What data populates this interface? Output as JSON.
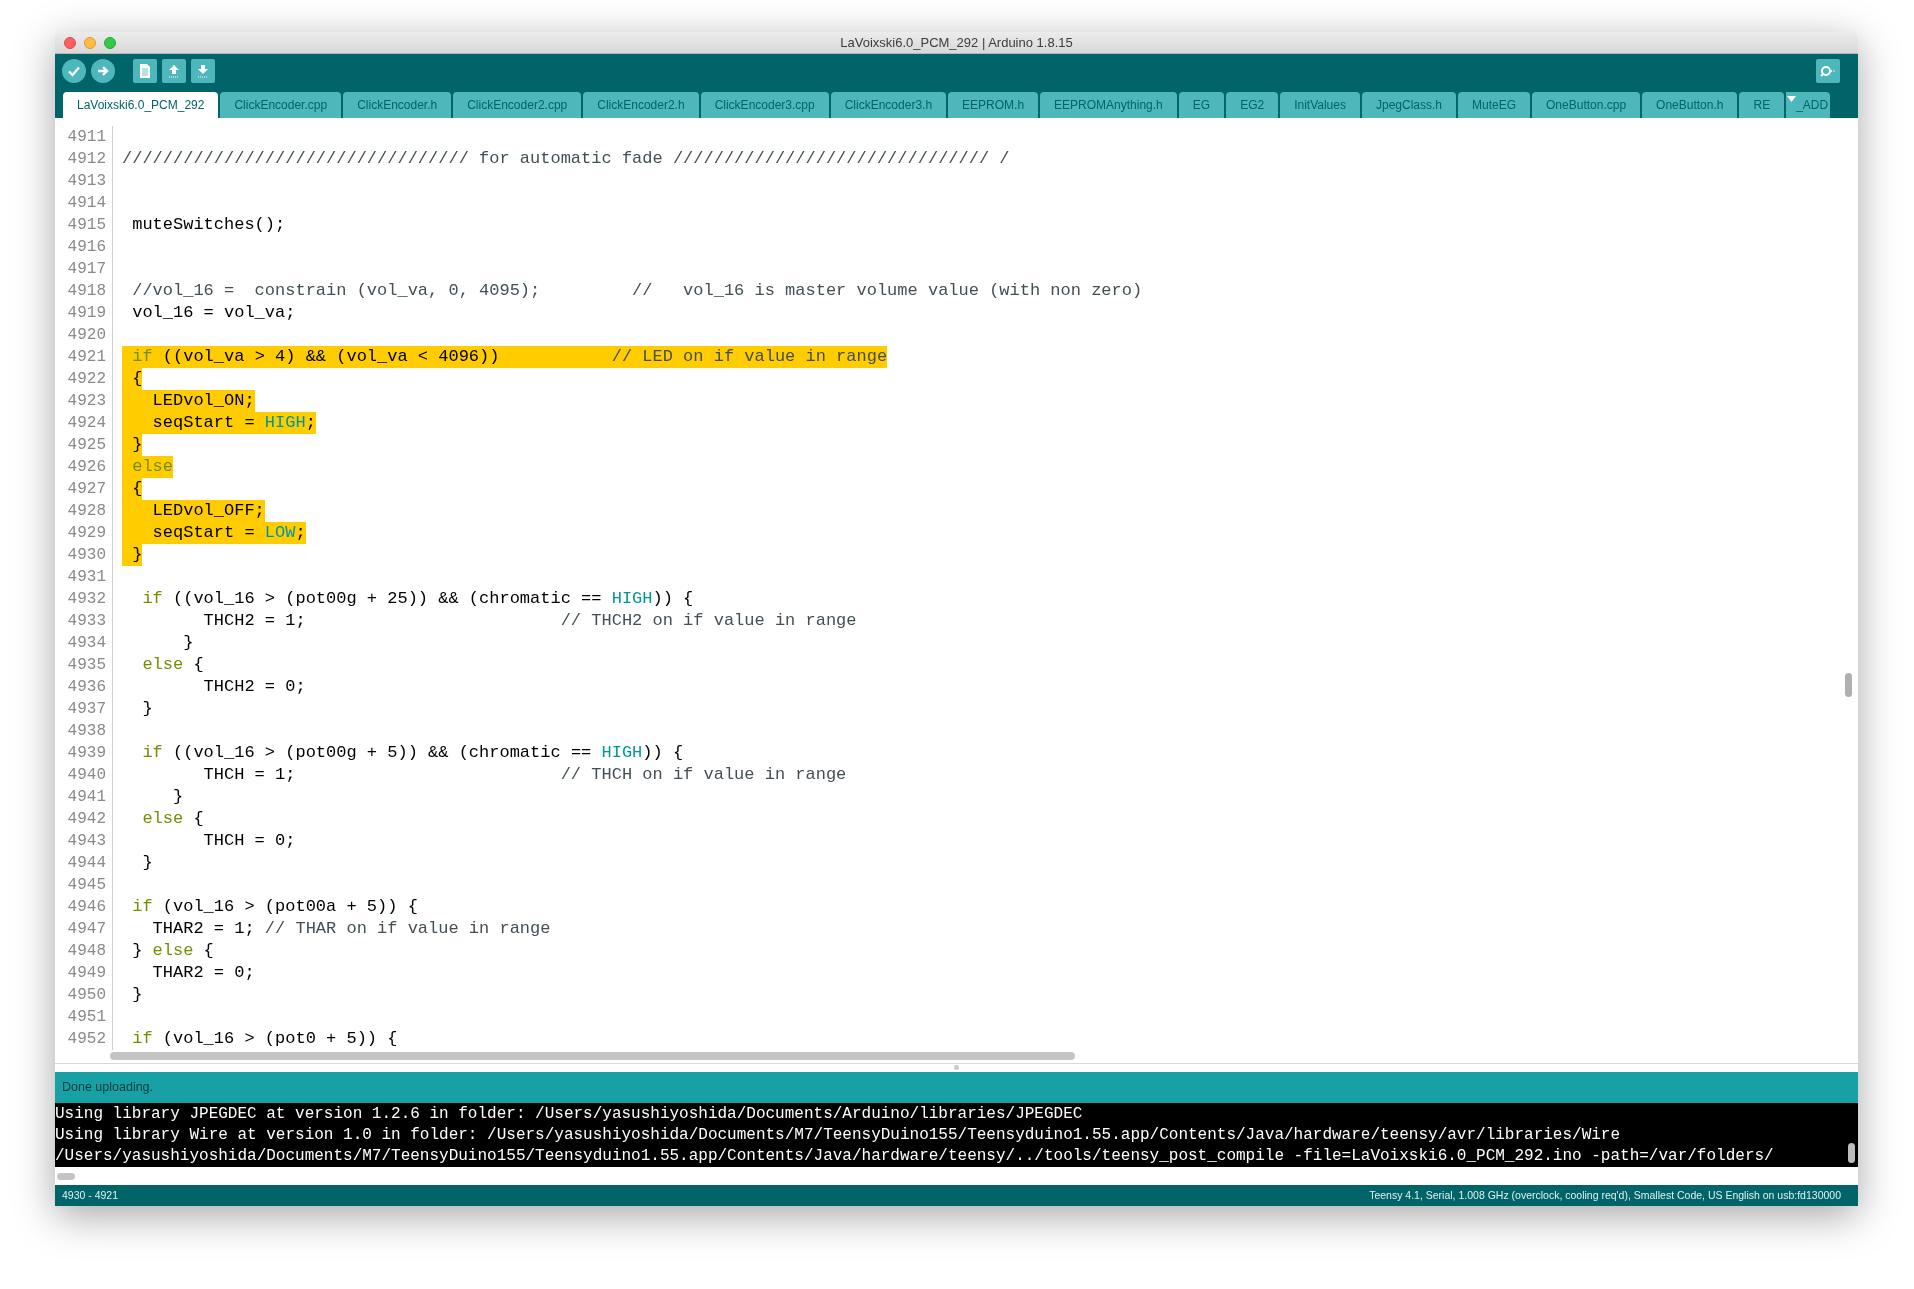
{
  "window": {
    "title": "LaVoixski6.0_PCM_292 | Arduino 1.8.15"
  },
  "tabs": [
    {
      "label": "LaVoixski6.0_PCM_292",
      "selected": true
    },
    {
      "label": "ClickEncoder.cpp",
      "selected": false
    },
    {
      "label": "ClickEncoder.h",
      "selected": false
    },
    {
      "label": "ClickEncoder2.cpp",
      "selected": false
    },
    {
      "label": "ClickEncoder2.h",
      "selected": false
    },
    {
      "label": "ClickEncoder3.cpp",
      "selected": false
    },
    {
      "label": "ClickEncoder3.h",
      "selected": false
    },
    {
      "label": "EEPROM.h",
      "selected": false
    },
    {
      "label": "EEPROMAnything.h",
      "selected": false
    },
    {
      "label": "EG",
      "selected": false
    },
    {
      "label": "EG2",
      "selected": false
    },
    {
      "label": "InitValues",
      "selected": false
    },
    {
      "label": "JpegClass.h",
      "selected": false
    },
    {
      "label": "MuteEG",
      "selected": false
    },
    {
      "label": "OneButton.cpp",
      "selected": false
    },
    {
      "label": "OneButton.h",
      "selected": false
    },
    {
      "label": "RE",
      "selected": false
    }
  ],
  "tabs_menu_text": "_ADD",
  "lines": [
    {
      "number": "4911"
    },
    {
      "number": "4912",
      "highlighted": false,
      "tokens": [
        {
          "text": "////////////////////////////////// for automatic fade /////////////////////////////// /",
          "kind": "comment"
        }
      ]
    },
    {
      "number": "4913"
    },
    {
      "number": "4914"
    },
    {
      "number": "4915",
      "highlighted": false,
      "tokens": [
        {
          "text": " muteSwitches();",
          "kind": "plain"
        }
      ]
    },
    {
      "number": "4916"
    },
    {
      "number": "4917"
    },
    {
      "number": "4918",
      "highlighted": false,
      "tokens": [
        {
          "text": " //vol_16 =  constrain (vol_va, 0, 4095);         //   vol_16 is master volume value (with non zero)",
          "kind": "comment"
        }
      ]
    },
    {
      "number": "4919",
      "highlighted": false,
      "tokens": [
        {
          "text": " vol_16 = vol_va;",
          "kind": "plain"
        }
      ]
    },
    {
      "number": "4920"
    },
    {
      "number": "4921",
      "highlighted": true,
      "tokens": [
        {
          "text": " if",
          "kind": "keyword"
        },
        {
          "text": " ((vol_va > 4) && (vol_va < 4096))           ",
          "kind": "plain"
        },
        {
          "text": "// LED on if value in range",
          "kind": "comment"
        }
      ]
    },
    {
      "number": "4922",
      "highlighted": true,
      "tokens": [
        {
          "text": " {",
          "kind": "plain"
        }
      ]
    },
    {
      "number": "4923",
      "highlighted": true,
      "tokens": [
        {
          "text": "   LEDvol_ON;",
          "kind": "plain"
        }
      ]
    },
    {
      "number": "4924",
      "highlighted": true,
      "tokens": [
        {
          "text": "   seqStart = ",
          "kind": "plain"
        },
        {
          "text": "HIGH",
          "kind": "constant"
        },
        {
          "text": ";",
          "kind": "plain"
        }
      ]
    },
    {
      "number": "4925",
      "highlighted": true,
      "tokens": [
        {
          "text": " }",
          "kind": "plain"
        }
      ]
    },
    {
      "number": "4926",
      "highlighted": true,
      "tokens": [
        {
          "text": " else",
          "kind": "keyword"
        }
      ]
    },
    {
      "number": "4927",
      "highlighted": true,
      "tokens": [
        {
          "text": " {",
          "kind": "plain"
        }
      ]
    },
    {
      "number": "4928",
      "highlighted": true,
      "tokens": [
        {
          "text": "   LEDvol_OFF;",
          "kind": "plain"
        }
      ]
    },
    {
      "number": "4929",
      "highlighted": true,
      "tokens": [
        {
          "text": "   seqStart = ",
          "kind": "plain"
        },
        {
          "text": "LOW",
          "kind": "constant"
        },
        {
          "text": ";",
          "kind": "plain"
        }
      ]
    },
    {
      "number": "4930",
      "highlighted": true,
      "tokens": [
        {
          "text": " }",
          "kind": "plain"
        }
      ]
    },
    {
      "number": "4931"
    },
    {
      "number": "4932",
      "highlighted": false,
      "tokens": [
        {
          "text": "  if",
          "kind": "keyword"
        },
        {
          "text": " ((vol_16 > (pot00g + 25)) && (chromatic == ",
          "kind": "plain"
        },
        {
          "text": "HIGH",
          "kind": "constant"
        },
        {
          "text": ")) {",
          "kind": "plain"
        }
      ]
    },
    {
      "number": "4933",
      "highlighted": false,
      "tokens": [
        {
          "text": "        THCH2 = 1;                         ",
          "kind": "plain"
        },
        {
          "text": "// THCH2 on if value in range",
          "kind": "comment"
        }
      ]
    },
    {
      "number": "4934",
      "highlighted": false,
      "tokens": [
        {
          "text": "      }",
          "kind": "plain"
        }
      ]
    },
    {
      "number": "4935",
      "highlighted": false,
      "tokens": [
        {
          "text": "  else",
          "kind": "keyword"
        },
        {
          "text": " {",
          "kind": "plain"
        }
      ]
    },
    {
      "number": "4936",
      "highlighted": false,
      "tokens": [
        {
          "text": "        THCH2 = 0;",
          "kind": "plain"
        }
      ]
    },
    {
      "number": "4937",
      "highlighted": false,
      "tokens": [
        {
          "text": "  }",
          "kind": "plain"
        }
      ]
    },
    {
      "number": "4938"
    },
    {
      "number": "4939",
      "highlighted": false,
      "tokens": [
        {
          "text": "  if",
          "kind": "keyword"
        },
        {
          "text": " ((vol_16 > (pot00g + 5)) && (chromatic == ",
          "kind": "plain"
        },
        {
          "text": "HIGH",
          "kind": "constant"
        },
        {
          "text": ")) {",
          "kind": "plain"
        }
      ]
    },
    {
      "number": "4940",
      "highlighted": false,
      "tokens": [
        {
          "text": "        THCH = 1;                          ",
          "kind": "plain"
        },
        {
          "text": "// THCH on if value in range",
          "kind": "comment"
        }
      ]
    },
    {
      "number": "4941",
      "highlighted": false,
      "tokens": [
        {
          "text": "     }",
          "kind": "plain"
        }
      ]
    },
    {
      "number": "4942",
      "highlighted": false,
      "tokens": [
        {
          "text": "  else",
          "kind": "keyword"
        },
        {
          "text": " {",
          "kind": "plain"
        }
      ]
    },
    {
      "number": "4943",
      "highlighted": false,
      "tokens": [
        {
          "text": "        THCH = 0;",
          "kind": "plain"
        }
      ]
    },
    {
      "number": "4944",
      "highlighted": false,
      "tokens": [
        {
          "text": "  }",
          "kind": "plain"
        }
      ]
    },
    {
      "number": "4945"
    },
    {
      "number": "4946",
      "highlighted": false,
      "tokens": [
        {
          "text": " if",
          "kind": "keyword"
        },
        {
          "text": " (vol_16 > (pot00a + 5)) {",
          "kind": "plain"
        }
      ]
    },
    {
      "number": "4947",
      "highlighted": false,
      "tokens": [
        {
          "text": "   THAR2 = 1; ",
          "kind": "plain"
        },
        {
          "text": "// THAR on if value in range",
          "kind": "comment"
        }
      ]
    },
    {
      "number": "4948",
      "highlighted": false,
      "tokens": [
        {
          "text": " } ",
          "kind": "plain"
        },
        {
          "text": "else",
          "kind": "keyword"
        },
        {
          "text": " {",
          "kind": "plain"
        }
      ]
    },
    {
      "number": "4949",
      "highlighted": false,
      "tokens": [
        {
          "text": "   THAR2 = 0;",
          "kind": "plain"
        }
      ]
    },
    {
      "number": "4950",
      "highlighted": false,
      "tokens": [
        {
          "text": " }",
          "kind": "plain"
        }
      ]
    },
    {
      "number": "4951"
    },
    {
      "number": "4952",
      "highlighted": false,
      "tokens": [
        {
          "text": " if",
          "kind": "keyword"
        },
        {
          "text": " (vol_16 > (pot0 + 5)) {",
          "kind": "plain"
        }
      ]
    }
  ],
  "message": "Done uploading.",
  "console": [
    "Using library JPEGDEC at version 1.2.6 in folder: /Users/yasushiyoshida/Documents/Arduino/libraries/JPEGDEC",
    "Using library Wire at version 1.0 in folder: /Users/yasushiyoshida/Documents/M7/TeensyDuino155/Teensyduino1.55.app/Contents/Java/hardware/teensy/avr/libraries/Wire",
    "/Users/yasushiyoshida/Documents/M7/TeensyDuino155/Teensyduino1.55.app/Contents/Java/hardware/teensy/../tools/teensy_post_compile -file=LaVoixski6.0_PCM_292.ino -path=/var/folders/"
  ],
  "status_bar": {
    "selection": "4930 - 4921",
    "board": "Teensy 4.1, Serial, 1.008 GHz (overclock, cooling req'd), Smallest Code, US English on usb:fd130000"
  }
}
